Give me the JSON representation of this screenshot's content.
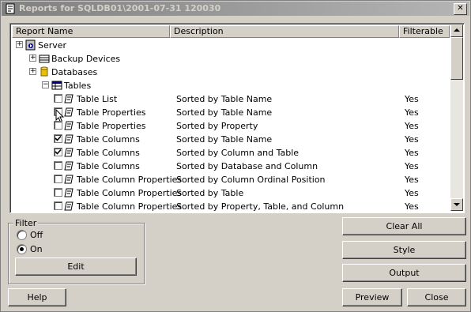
{
  "window": {
    "title": "Reports for SQLDB01\\2001-07-31 120030",
    "close_label": "✕"
  },
  "grid": {
    "columns": [
      "Report Name",
      "Description",
      "Filterable"
    ],
    "tree": [
      {
        "label": "Server",
        "expander": "+",
        "level": 0,
        "icon": "server-icon"
      },
      {
        "label": "Backup Devices",
        "expander": "+",
        "level": 1,
        "icon": "backup-devices-icon"
      },
      {
        "label": "Databases",
        "expander": "+",
        "level": 1,
        "icon": "database-icon"
      },
      {
        "label": "Tables",
        "expander": "−",
        "level": 2,
        "icon": "tables-icon"
      }
    ],
    "reports": [
      {
        "name": "Table List",
        "description": "Sorted by Table Name",
        "filterable": "Yes",
        "checked": false
      },
      {
        "name": "Table Properties",
        "description": "Sorted by Table Name",
        "filterable": "Yes",
        "checked": false
      },
      {
        "name": "Table Properties",
        "description": "Sorted by Property",
        "filterable": "Yes",
        "checked": false
      },
      {
        "name": "Table Columns",
        "description": "Sorted by Table Name",
        "filterable": "Yes",
        "checked": true
      },
      {
        "name": "Table Columns",
        "description": "Sorted by Column and Table",
        "filterable": "Yes",
        "checked": true
      },
      {
        "name": "Table Columns",
        "description": "Sorted by Database and Column",
        "filterable": "Yes",
        "checked": false
      },
      {
        "name": "Table Column Properties",
        "description": "Sorted by Column Ordinal Position",
        "filterable": "Yes",
        "checked": false
      },
      {
        "name": "Table Column Properties",
        "description": "Sorted by Table",
        "filterable": "Yes",
        "checked": false
      },
      {
        "name": "Table Column Properties",
        "description": "Sorted by Property, Table, and Column",
        "filterable": "Yes",
        "checked": false
      }
    ]
  },
  "filter": {
    "group_label": "Filter",
    "options": [
      {
        "label": "Off",
        "selected": false
      },
      {
        "label": "On",
        "selected": true
      }
    ],
    "edit_label": "Edit"
  },
  "buttons": {
    "clear_all": "Clear All",
    "style": "Style",
    "output": "Output",
    "help": "Help",
    "preview": "Preview",
    "close": "Close"
  }
}
